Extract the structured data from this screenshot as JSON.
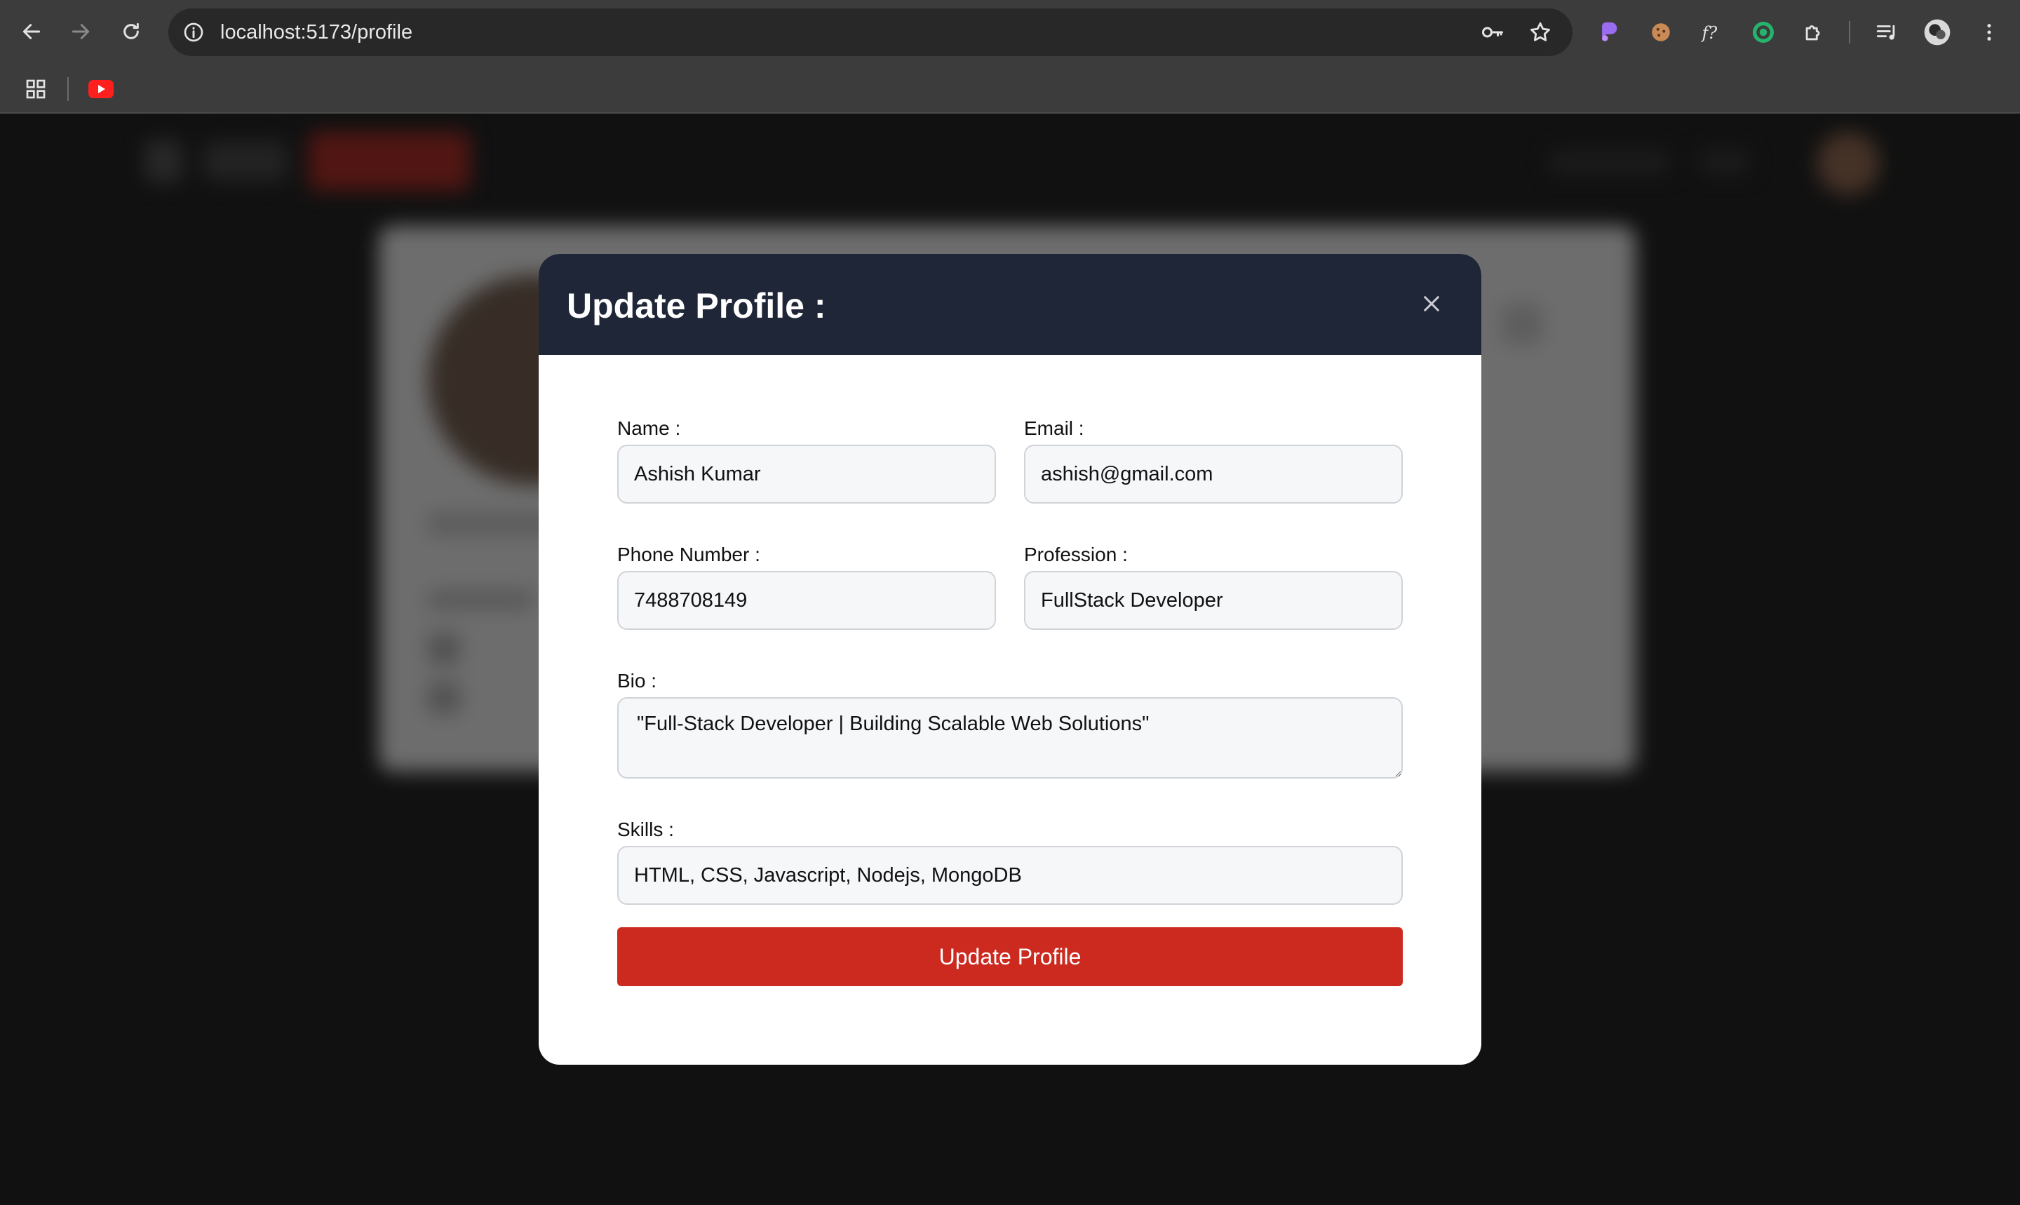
{
  "browser": {
    "url": "localhost:5173/profile",
    "nav": {
      "back_icon": "arrow-left-icon",
      "forward_icon": "arrow-right-icon",
      "reload_icon": "reload-icon"
    },
    "omnibox_icons": [
      "site-info-icon",
      "password-key-icon",
      "bookmark-star-icon"
    ],
    "extensions": [
      "purple-extension-icon",
      "cookie-icon",
      "font-f-icon",
      "target-extension-icon",
      "puzzle-extensions-icon",
      "media-queue-icon",
      "profile-avatar-icon",
      "kebab-menu-icon"
    ],
    "bookmarks": [
      "apps-grid-icon",
      "youtube-icon"
    ]
  },
  "modal": {
    "title": "Update Profile :",
    "close_icon": "close-x-icon",
    "fields": {
      "name": {
        "label": "Name :",
        "value": "Ashish Kumar"
      },
      "email": {
        "label": "Email :",
        "value": "ashish@gmail.com"
      },
      "phone": {
        "label": "Phone Number :",
        "value": "7488708149"
      },
      "profession": {
        "label": "Profession :",
        "value": "FullStack Developer"
      },
      "bio": {
        "label": "Bio :",
        "value": "\"Full-Stack Developer | Building Scalable Web Solutions\""
      },
      "skills": {
        "label": "Skills :",
        "value": "HTML, CSS, Javascript, Nodejs, MongoDB"
      }
    },
    "submit_label": "Update Profile"
  },
  "colors": {
    "modal_header": "#1f2637",
    "submit_button": "#cc291f",
    "backdrop": "#262626"
  }
}
